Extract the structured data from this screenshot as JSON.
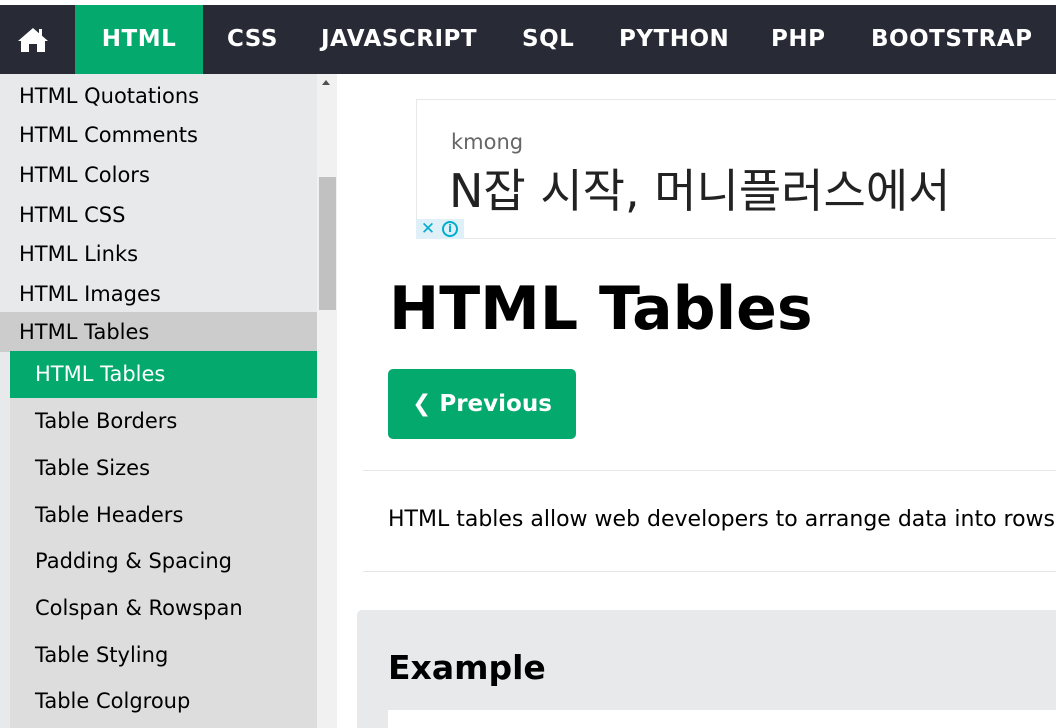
{
  "topnav": {
    "home_icon": "home-icon",
    "items": [
      "HTML",
      "CSS",
      "JAVASCRIPT",
      "SQL",
      "PYTHON",
      "PHP",
      "BOOTSTRAP"
    ],
    "active": "HTML",
    "background": "#282a35",
    "accent": "#04aa6d"
  },
  "sidebar": {
    "links": [
      "HTML Quotations",
      "HTML Comments",
      "HTML Colors",
      "HTML CSS",
      "HTML Links",
      "HTML Images"
    ],
    "group_label": "HTML Tables",
    "subitems": [
      "HTML Tables",
      "Table Borders",
      "Table Sizes",
      "Table Headers",
      "Padding & Spacing",
      "Colspan & Rowspan",
      "Table Styling",
      "Table Colgroup"
    ],
    "active_subitem": "HTML Tables"
  },
  "ad": {
    "brand": "kmong",
    "headline": "N잡 시작, 머니플러스에서",
    "close_glyph": "✕",
    "info_glyph": "i"
  },
  "main": {
    "title": "HTML Tables",
    "prev_label": "❮ Previous",
    "intro": "HTML tables allow web developers to arrange data into rows and columns.",
    "example_title": "Example"
  }
}
